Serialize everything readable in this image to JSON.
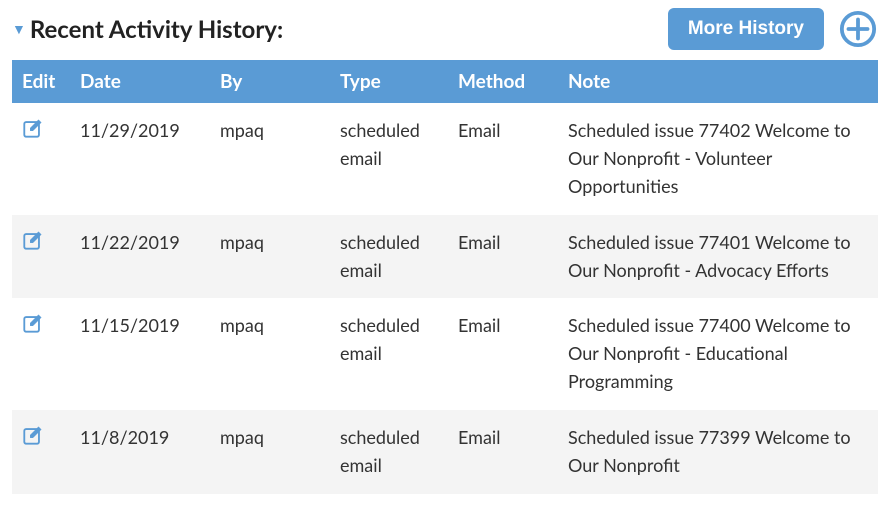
{
  "section": {
    "title": "Recent Activity History:"
  },
  "actions": {
    "more_history_label": "More History"
  },
  "table": {
    "headers": {
      "edit": "Edit",
      "date": "Date",
      "by": "By",
      "type": "Type",
      "method": "Method",
      "note": "Note"
    },
    "rows": [
      {
        "date": "11/29/2019",
        "by": "mpaq",
        "type": "scheduled email",
        "method": "Email",
        "note": "Scheduled issue 77402 Welcome to Our Nonprofit - Volunteer Opportunities"
      },
      {
        "date": "11/22/2019",
        "by": "mpaq",
        "type": "scheduled email",
        "method": "Email",
        "note": "Scheduled issue 77401 Welcome to Our Nonprofit - Advocacy Efforts"
      },
      {
        "date": "11/15/2019",
        "by": "mpaq",
        "type": "scheduled email",
        "method": "Email",
        "note": "Scheduled issue 77400 Welcome to Our Nonprofit - Educational Programming"
      },
      {
        "date": "11/8/2019",
        "by": "mpaq",
        "type": "scheduled email",
        "method": "Email",
        "note": "Scheduled issue 77399 Welcome to Our Nonprofit"
      }
    ]
  }
}
